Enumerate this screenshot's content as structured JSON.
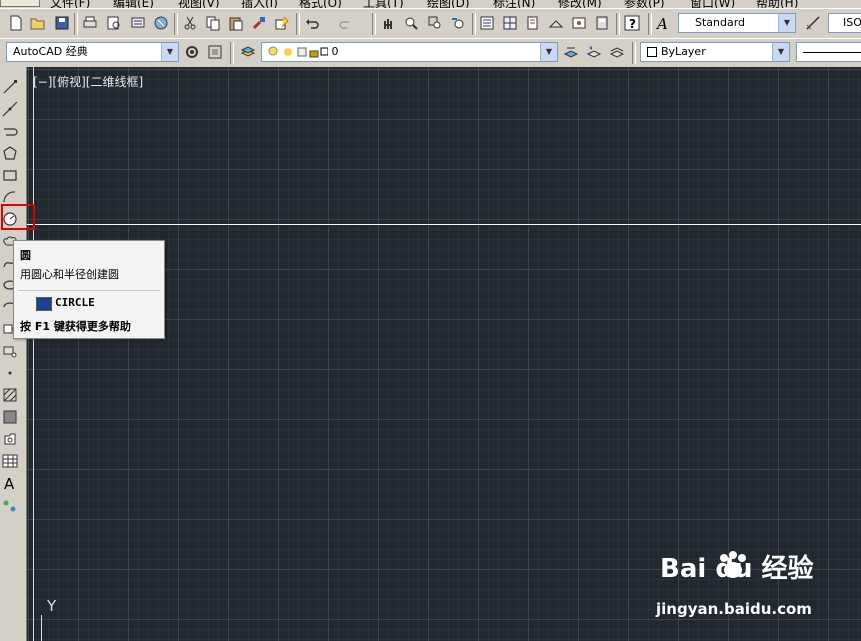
{
  "menu": [
    "文件(F)",
    "编辑(E)",
    "视图(V)",
    "插入(I)",
    "格式(O)",
    "工具(T)",
    "绘图(D)",
    "标注(N)",
    "修改(M)",
    "参数(P)",
    "窗口(W)",
    "帮助(H)"
  ],
  "toolbar": {
    "text_style": "Standard",
    "dim_style_partial": "ISO",
    "workspace": "AutoCAD 经典",
    "layer": "0",
    "color": "ByLayer"
  },
  "viewport": {
    "label": "[−][俯视][二维线框]",
    "y_axis": "Y"
  },
  "tooltip": {
    "title": "圆",
    "description": "用圆心和半径创建圆",
    "command": "CIRCLE",
    "help": "按 F1 键获得更多帮助"
  },
  "watermark": {
    "brand": "Bai du 经验",
    "url": "jingyan.baidu.com"
  },
  "icons": {
    "top": [
      "new-icon",
      "open-icon",
      "save-icon",
      "plot-icon",
      "plot-preview-icon",
      "publish-icon",
      "3d-dwf-icon",
      "cut-icon",
      "copy-icon",
      "paste-icon",
      "match-properties-icon",
      "block-editor-icon",
      "undo-icon",
      "redo-icon",
      "pan-icon",
      "zoom-realtime-icon",
      "zoom-window-icon",
      "zoom-previous-icon",
      "properties-icon",
      "design-center-icon",
      "tool-palettes-icon",
      "sheet-set-icon",
      "markup-icon",
      "calculator-icon",
      "help-icon"
    ],
    "left": [
      "line-icon",
      "construction-line-icon",
      "polyline-icon",
      "polygon-icon",
      "rectangle-icon",
      "arc-icon",
      "circle-icon",
      "revision-cloud-icon",
      "spline-icon",
      "ellipse-icon",
      "ellipse-arc-icon",
      "insert-block-icon",
      "make-block-icon",
      "point-icon",
      "hatch-icon",
      "gradient-icon",
      "region-icon",
      "table-icon",
      "multiline-text-icon",
      "add-selected-icon"
    ]
  },
  "colors": {
    "canvas": "#212830",
    "highlight": "#e00000"
  }
}
